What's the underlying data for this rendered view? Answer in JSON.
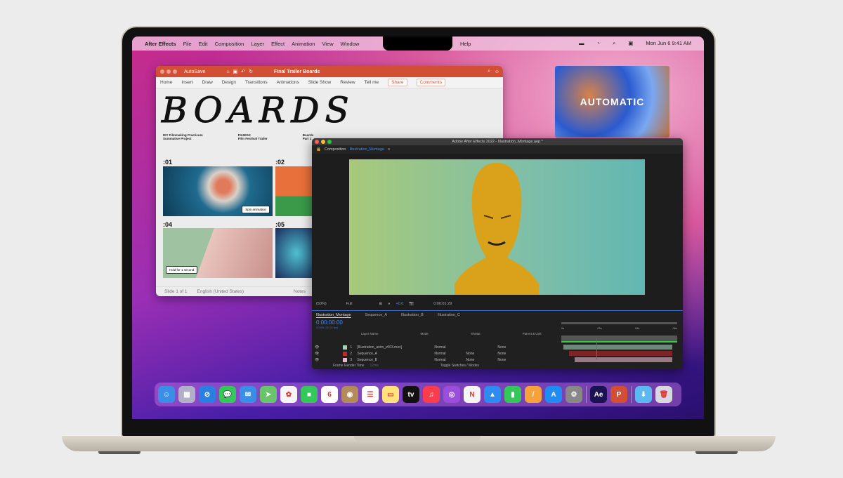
{
  "menubar": {
    "app": "After Effects",
    "items": [
      "File",
      "Edit",
      "Composition",
      "Layer",
      "Effect",
      "Animation",
      "View",
      "Window"
    ],
    "help": "Help",
    "clock": "Mon Jun 6  9:41 AM"
  },
  "desktop_art": {
    "text": "AUTOMATIC"
  },
  "powerpoint": {
    "autosave": "AutoSave",
    "title": "Final Trailer Boards",
    "tabs": [
      "Home",
      "Insert",
      "Draw",
      "Design",
      "Transitions",
      "Animations",
      "Slide Show",
      "Review"
    ],
    "tell_me": "Tell me",
    "share": "Share",
    "comments": "Comments",
    "heading": "BOARDS",
    "meta": [
      "DIY Filmmaking Practicum\nSummative Project",
      "FILM012\nFilm Festival Trailer",
      "Boards\nPart 1"
    ],
    "slots": [
      ":01",
      ":02",
      ":04",
      ":05"
    ],
    "tag1": "Spin animation",
    "tag2": "Hold for 1 second",
    "status": {
      "slide": "Slide 1 of 1",
      "language": "English (United States)",
      "notes": "Notes"
    }
  },
  "aftereffects": {
    "title": "Adobe After Effects 2022 - Illustration_Montage.aep *",
    "panel": "Composition",
    "comp_name": "Illustration_Montage",
    "viewer": {
      "zoom": "(50%)",
      "resolution": "Full",
      "exposure": "+0.0",
      "timecode": "0:00:01:29"
    },
    "timeline": {
      "tabs": [
        "Illustration_Montage",
        "Sequence_A",
        "Illustration_B",
        "Illustration_C"
      ],
      "current_time": "0:00:00:00",
      "fps": "00000 (30.00 fps)",
      "columns": [
        "Layer Name",
        "Mode",
        "T",
        "TrkMat",
        "Parent & Link"
      ],
      "ruler": [
        "0s",
        "02s",
        "04s",
        "06s"
      ],
      "layers": [
        {
          "num": "1",
          "name": "[Illustration_anim_v003.mov]",
          "mode": "Normal",
          "trkmat": "",
          "parent": "None",
          "color": "#9fd3b8"
        },
        {
          "num": "2",
          "name": "Sequence_A",
          "mode": "Normal",
          "trkmat": "None",
          "parent": "None",
          "color": "#c0282c"
        },
        {
          "num": "3",
          "name": "Sequence_B",
          "mode": "Normal",
          "trkmat": "None",
          "parent": "None",
          "color": "#e8b7c8"
        }
      ],
      "footer": {
        "render_time": "Frame Render Time",
        "render_value": "12ms",
        "toggle": "Toggle Switches / Modes"
      }
    }
  },
  "dock": {
    "apps": [
      {
        "name": "finder",
        "color": "#3a8ee6",
        "glyph": "☺"
      },
      {
        "name": "launchpad",
        "color": "#b0b0c8",
        "glyph": "▦"
      },
      {
        "name": "safari",
        "color": "#2a7fe0",
        "glyph": "⊘"
      },
      {
        "name": "messages",
        "color": "#34c759",
        "glyph": "💬"
      },
      {
        "name": "mail",
        "color": "#3a8ee6",
        "glyph": "✉"
      },
      {
        "name": "maps",
        "color": "#6ac46a",
        "glyph": "➤"
      },
      {
        "name": "photos",
        "color": "#f5f5f5",
        "glyph": "✿"
      },
      {
        "name": "facetime",
        "color": "#34c759",
        "glyph": "■"
      },
      {
        "name": "calendar",
        "color": "#ffffff",
        "glyph": "6"
      },
      {
        "name": "contacts",
        "color": "#b38a5a",
        "glyph": "◉"
      },
      {
        "name": "reminders",
        "color": "#ffffff",
        "glyph": "☰"
      },
      {
        "name": "notes",
        "color": "#ffe27a",
        "glyph": "▭"
      },
      {
        "name": "tv",
        "color": "#111111",
        "glyph": "tv"
      },
      {
        "name": "music",
        "color": "#fa3c4c",
        "glyph": "♫"
      },
      {
        "name": "podcasts",
        "color": "#9b4ddb",
        "glyph": "◎"
      },
      {
        "name": "news",
        "color": "#f5f5f5",
        "glyph": "N"
      },
      {
        "name": "keynote",
        "color": "#2e8bf0",
        "glyph": "▲"
      },
      {
        "name": "numbers",
        "color": "#34c759",
        "glyph": "▮"
      },
      {
        "name": "pages",
        "color": "#f7a13a",
        "glyph": "/"
      },
      {
        "name": "app-store",
        "color": "#1f8bf5",
        "glyph": "A"
      },
      {
        "name": "system-preferences",
        "color": "#888888",
        "glyph": "⚙"
      },
      {
        "name": "after-effects",
        "color": "#1a1252",
        "glyph": "Ae"
      },
      {
        "name": "powerpoint",
        "color": "#d24f35",
        "glyph": "P"
      },
      {
        "name": "downloads",
        "color": "#5bb8f0",
        "glyph": "⬇"
      },
      {
        "name": "trash",
        "color": "#d8d8e0",
        "glyph": "🗑"
      }
    ]
  }
}
